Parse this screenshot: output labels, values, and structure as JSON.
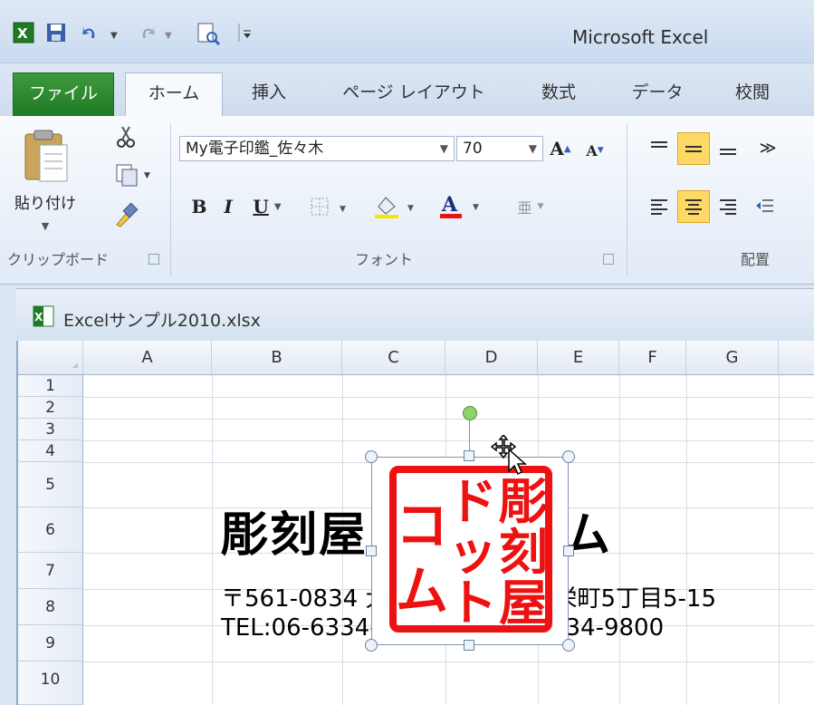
{
  "app": {
    "title": "Microsoft Excel"
  },
  "tabs": [
    {
      "label": "ファイル"
    },
    {
      "label": "ホーム"
    },
    {
      "label": "挿入"
    },
    {
      "label": "ページ レイアウト"
    },
    {
      "label": "数式"
    },
    {
      "label": "データ"
    },
    {
      "label": "校閲"
    }
  ],
  "clipboard": {
    "paste_label": "貼り付け",
    "group_label": "クリップボード"
  },
  "font": {
    "name": "My電子印鑑_佐々木",
    "size": "70",
    "group_label": "フォント"
  },
  "alignment": {
    "group_label": "配置"
  },
  "workbook": {
    "filename": "Excelサンプル2010.xlsx"
  },
  "columns": [
    "A",
    "B",
    "C",
    "D",
    "E",
    "F",
    "G"
  ],
  "rows": [
    "1",
    "2",
    "3",
    "4",
    "5",
    "6",
    "7",
    "8",
    "9",
    "10"
  ],
  "cells": {
    "company": "彫刻屋ドットコム",
    "address": "〒561-0834 大阪府豊中市庄内栄町5丁目5-15",
    "tel": "TEL:06-6334-9800 FAX:06-6334-9800"
  },
  "stamp": {
    "chars_right": "彫刻屋",
    "chars_middle": "ドット",
    "chars_left": "コム",
    "color": "#ee1111"
  },
  "colors": {
    "file_tab": "#2a8a2e",
    "stamp_red": "#ee1111",
    "highlight": "#ffd966"
  }
}
